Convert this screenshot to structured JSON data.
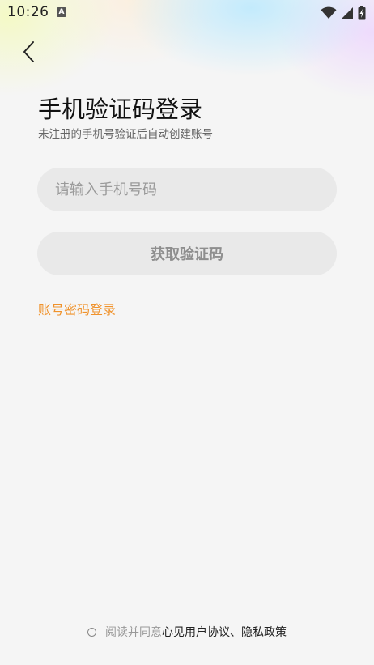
{
  "status_bar": {
    "time": "10:26",
    "app_icon_letter": "A",
    "icons": [
      "wifi-icon",
      "cellular-signal-icon",
      "battery-charging-icon"
    ]
  },
  "header": {
    "back_icon": "chevron-left-icon"
  },
  "login": {
    "title": "手机验证码登录",
    "subtitle": "未注册的手机号验证后自动创建账号",
    "phone_placeholder": "请输入手机号码",
    "phone_value": "",
    "get_code_label": "获取验证码",
    "password_login_label": "账号密码登录"
  },
  "agreement": {
    "checked": false,
    "prefix": "阅读并同意",
    "user_agreement": "心见用户协议",
    "separator": "、",
    "privacy_policy": "隐私政策"
  },
  "colors": {
    "accent": "#f0922b",
    "background": "#f5f5f5",
    "input_bg": "#e9e9e9"
  }
}
